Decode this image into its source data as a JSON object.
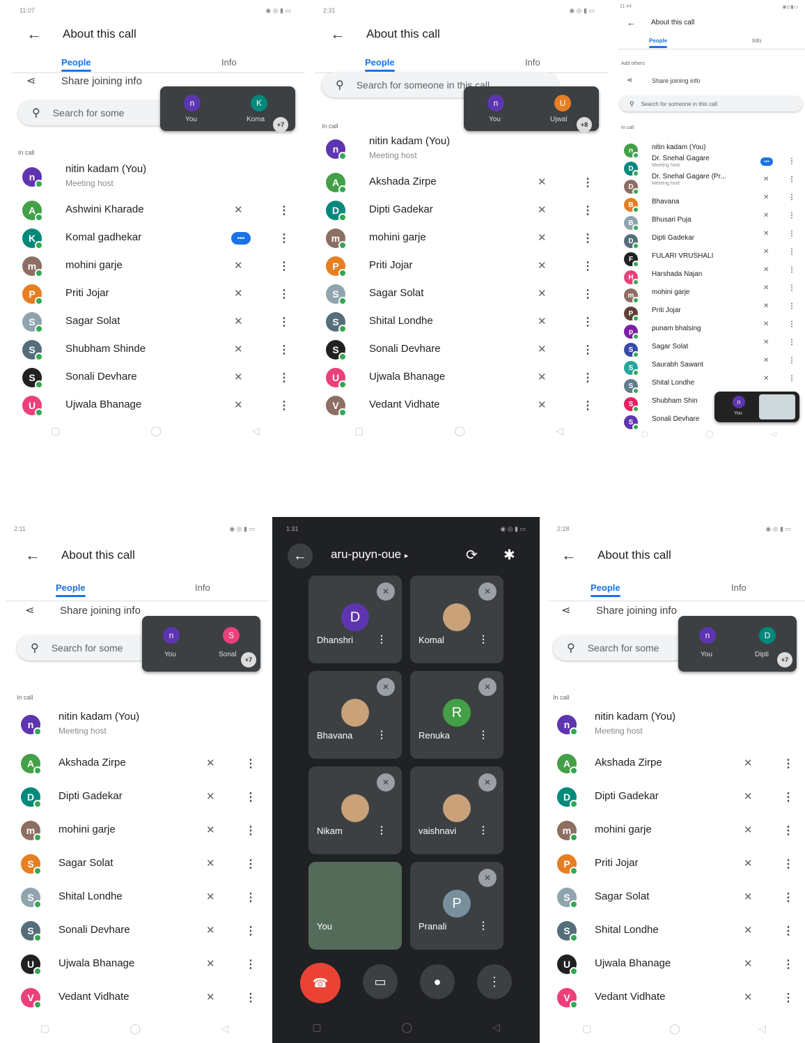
{
  "colors": {
    "accent": "#1a73e8",
    "end_call": "#ea4335",
    "online": "#34a853"
  },
  "screens": [
    {
      "time": "11:07",
      "title": "About this call",
      "tab_people": "People",
      "tab_info": "Info",
      "share": "Share joining info",
      "search": "Search for some",
      "in_call": "In call",
      "pip": {
        "a": "n",
        "a_label": "You",
        "b": "K",
        "b_label": "Koma",
        "badge": "+7"
      },
      "host": {
        "name": "nitin kadam (You)",
        "role": "Meeting host",
        "avatar": "n"
      },
      "people": [
        {
          "name": "Ashwini Kharade",
          "avatar": "A"
        },
        {
          "name": "Komal gadhekar",
          "avatar": "K",
          "speaking": true
        },
        {
          "name": "mohini garje",
          "avatar": "m"
        },
        {
          "name": "Priti Jojar",
          "avatar": "P"
        },
        {
          "name": "Sagar Solat",
          "avatar": "S"
        },
        {
          "name": "Shubham Shinde",
          "avatar": "S"
        },
        {
          "name": "Sonali Devhare",
          "avatar": "S"
        },
        {
          "name": "Ujwala Bhanage",
          "avatar": "U"
        }
      ]
    },
    {
      "time": "2:31",
      "title": "About this call",
      "tab_people": "People",
      "tab_info": "Info",
      "search": "Search for someone in this call",
      "in_call": "In call",
      "pip": {
        "a": "n",
        "a_label": "You",
        "b": "U",
        "b_label": "Ujwal",
        "badge": "+8"
      },
      "host": {
        "name": "nitin kadam (You)",
        "role": "Meeting host",
        "avatar": "n"
      },
      "people": [
        {
          "name": "Akshada Zirpe",
          "avatar": "A"
        },
        {
          "name": "Dipti Gadekar",
          "avatar": "D"
        },
        {
          "name": "mohini garje",
          "avatar": "m"
        },
        {
          "name": "Priti Jojar",
          "avatar": "P"
        },
        {
          "name": "Sagar Solat",
          "avatar": "S"
        },
        {
          "name": "Shital Londhe",
          "avatar": "S"
        },
        {
          "name": "Sonali Devhare",
          "avatar": "S"
        },
        {
          "name": "Ujwala Bhanage",
          "avatar": "U"
        },
        {
          "name": "Vedant Vidhate",
          "avatar": "V"
        }
      ]
    },
    {
      "time": "11:44",
      "title": "About this call",
      "tab_people": "People",
      "tab_info": "Info",
      "add_others": "Add others",
      "share": "Share joining info",
      "search": "Search for someone in this call",
      "in_call": "In call",
      "pip_label": "You",
      "people": [
        {
          "name": "nitin kadam (You)",
          "avatar": "n"
        },
        {
          "name": "Dr. Snehal Gagare",
          "sub": "Meeting host",
          "avatar": "D",
          "speaking": true
        },
        {
          "name": "Dr. Snehal Gagare (Pr...",
          "sub": "Meeting host",
          "avatar": "D"
        },
        {
          "name": "Bhavana",
          "avatar": "B"
        },
        {
          "name": "Bhusari Puja",
          "avatar": "B"
        },
        {
          "name": "Dipti Gadekar",
          "avatar": "D"
        },
        {
          "name": "FULARI VRUSHALI",
          "avatar": "F"
        },
        {
          "name": "Harshada Najan",
          "avatar": "H"
        },
        {
          "name": "mohini garje",
          "avatar": "m"
        },
        {
          "name": "Priti Jojar",
          "avatar": "P"
        },
        {
          "name": "punam bhalsing",
          "avatar": "p"
        },
        {
          "name": "Sagar Solat",
          "avatar": "S"
        },
        {
          "name": "Saurabh Sawant",
          "avatar": "S"
        },
        {
          "name": "Shital Londhe",
          "avatar": "S"
        },
        {
          "name": "Shubham Shin",
          "avatar": "S"
        },
        {
          "name": "Sonali Devhare",
          "avatar": "S"
        }
      ]
    },
    {
      "time": "2:11",
      "title": "About this call",
      "tab_people": "People",
      "tab_info": "Info",
      "share": "Share joining info",
      "search": "Search for some",
      "in_call": "In call",
      "pip": {
        "a": "n",
        "a_label": "You",
        "b": "S",
        "b_label": "Sonal",
        "badge": "+7"
      },
      "host": {
        "name": "nitin kadam (You)",
        "role": "Meeting host",
        "avatar": "n"
      },
      "people": [
        {
          "name": "Akshada Zirpe",
          "avatar": "A"
        },
        {
          "name": "Dipti Gadekar",
          "avatar": "D"
        },
        {
          "name": "mohini garje",
          "avatar": "m"
        },
        {
          "name": "Sagar Solat",
          "avatar": "S"
        },
        {
          "name": "Shital Londhe",
          "avatar": "S"
        },
        {
          "name": "Sonali Devhare",
          "avatar": "S"
        },
        {
          "name": "Ujwala Bhanage",
          "avatar": "U"
        },
        {
          "name": "Vedant Vidhate",
          "avatar": "V"
        }
      ]
    },
    {
      "time": "1:31",
      "meeting_code": "aru-puyn-oue",
      "tiles": [
        {
          "name": "Dhanshri",
          "avatar": "D"
        },
        {
          "name": "Komal",
          "avatar": ""
        },
        {
          "name": "Bhavana",
          "avatar": ""
        },
        {
          "name": "Renuka",
          "avatar": "R"
        },
        {
          "name": "Nikam",
          "avatar": ""
        },
        {
          "name": "vaishnavi",
          "avatar": ""
        },
        {
          "name": "You",
          "avatar": ""
        },
        {
          "name": "Pranali",
          "avatar": "P"
        }
      ]
    },
    {
      "time": "2:28",
      "title": "About this call",
      "tab_people": "People",
      "tab_info": "Info",
      "share": "Share joining info",
      "search": "Search for some",
      "in_call": "In call",
      "pip": {
        "a": "n",
        "a_label": "You",
        "b": "D",
        "b_label": "Dipti",
        "badge": "+7"
      },
      "host": {
        "name": "nitin kadam (You)",
        "role": "Meeting host",
        "avatar": "n"
      },
      "people": [
        {
          "name": "Akshada Zirpe",
          "avatar": "A"
        },
        {
          "name": "Dipti Gadekar",
          "avatar": "D"
        },
        {
          "name": "mohini garje",
          "avatar": "m"
        },
        {
          "name": "Priti Jojar",
          "avatar": "P"
        },
        {
          "name": "Sagar Solat",
          "avatar": "S"
        },
        {
          "name": "Shital Londhe",
          "avatar": "S"
        },
        {
          "name": "Ujwala Bhanage",
          "avatar": "U"
        },
        {
          "name": "Vedant Vidhate",
          "avatar": "V"
        }
      ]
    }
  ]
}
